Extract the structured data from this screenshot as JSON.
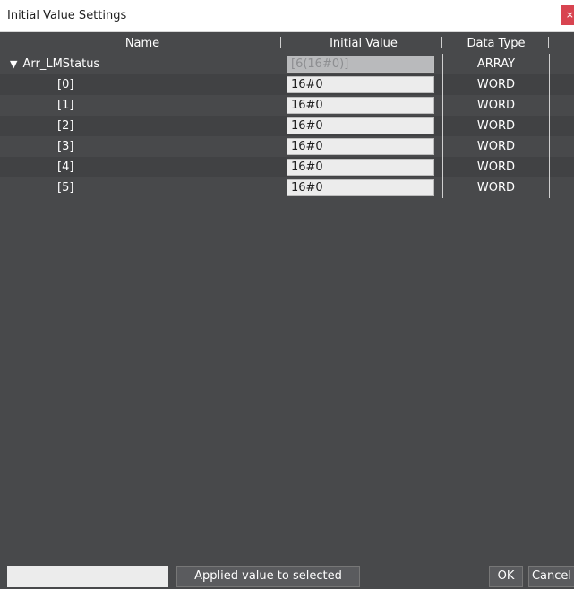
{
  "window": {
    "title": "Initial Value Settings",
    "close_glyph": "×"
  },
  "columns": {
    "name": "Name",
    "initial_value": "Initial Value",
    "data_type": "Data Type"
  },
  "rows": [
    {
      "name": "Arr_LMStatus",
      "value": "[6(16#0)]",
      "type": "ARRAY",
      "expanded": true
    },
    {
      "name": "[0]",
      "value": "16#0",
      "type": "WORD"
    },
    {
      "name": "[1]",
      "value": "16#0",
      "type": "WORD"
    },
    {
      "name": "[2]",
      "value": "16#0",
      "type": "WORD"
    },
    {
      "name": "[3]",
      "value": "16#0",
      "type": "WORD"
    },
    {
      "name": "[4]",
      "value": "16#0",
      "type": "WORD"
    },
    {
      "name": "[5]",
      "value": "16#0",
      "type": "WORD"
    }
  ],
  "footer": {
    "apply_label": "Applied value to selected items",
    "ok_label": "OK",
    "cancel_label": "Cancel"
  },
  "colors": {
    "background": "#48494b",
    "row_alt": "#414244",
    "close_button": "#d84450"
  }
}
